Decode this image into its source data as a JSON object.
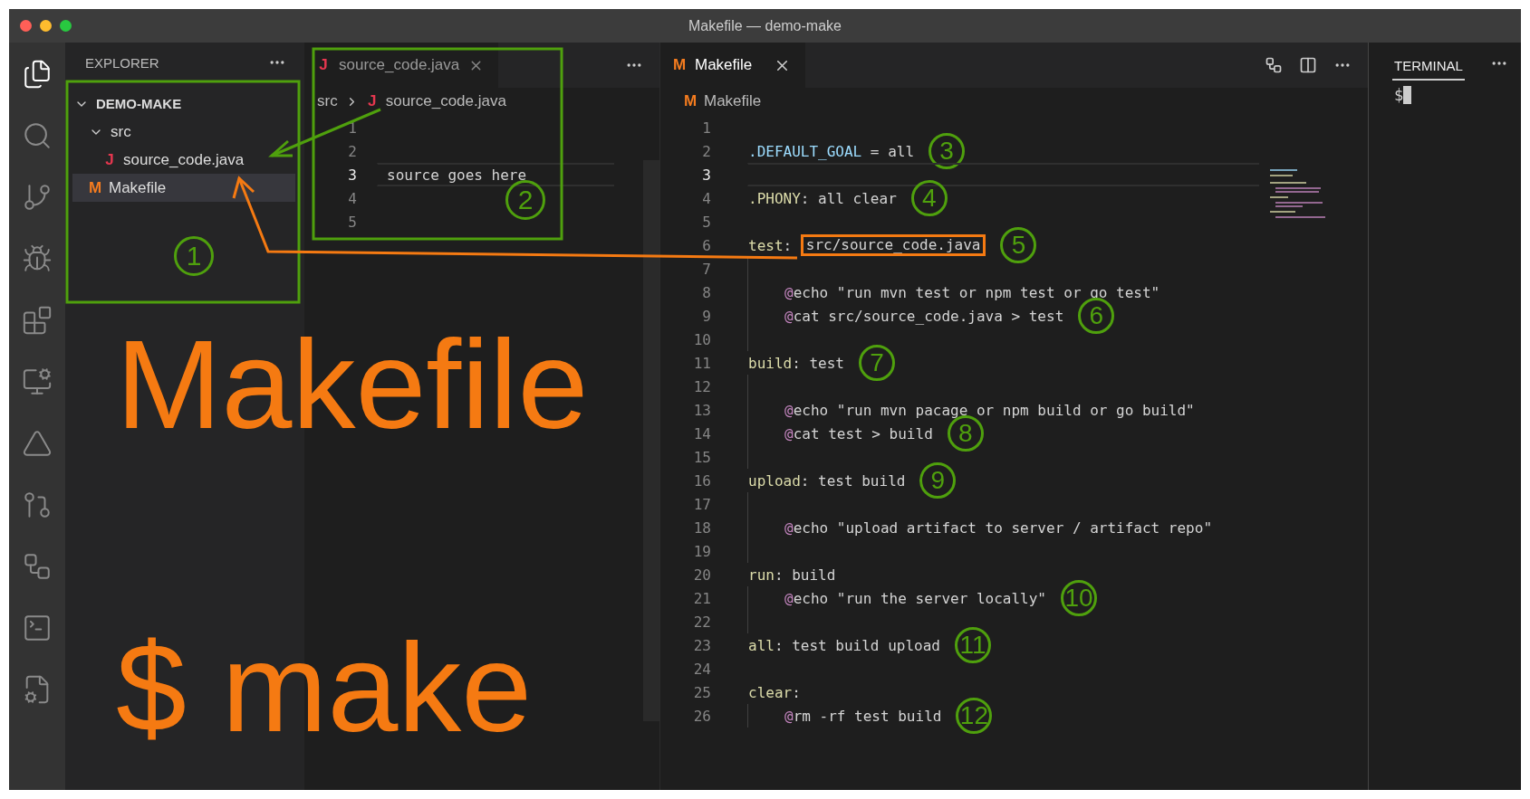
{
  "window": {
    "title": "Makefile — demo-make"
  },
  "activity_bar": [
    {
      "kind": "files",
      "selected": true
    },
    {
      "kind": "search",
      "selected": false
    },
    {
      "kind": "source-control",
      "selected": false
    },
    {
      "kind": "run",
      "selected": false
    },
    {
      "kind": "extensions",
      "selected": false
    },
    {
      "kind": "remote",
      "selected": false
    },
    {
      "kind": "terraform",
      "selected": false
    },
    {
      "kind": "pull-request",
      "selected": false
    },
    {
      "kind": "workflow",
      "selected": false
    },
    {
      "kind": "terminal",
      "selected": false
    },
    {
      "kind": "file-settings",
      "selected": false
    }
  ],
  "explorer": {
    "title": "EXPLORER",
    "callout": "1",
    "tree": [
      {
        "label": "DEMO-MAKE",
        "kind": "root",
        "expanded": true,
        "selected": false,
        "children": [
          {
            "label": "src",
            "kind": "folder",
            "expanded": true,
            "selected": false,
            "children": [
              {
                "label": "source_code.java",
                "kind": "file",
                "icon": "J",
                "color": "#e5374f",
                "selected": false
              }
            ]
          },
          {
            "label": "Makefile",
            "kind": "file",
            "icon": "M",
            "color": "#f57c1f",
            "selected": true
          }
        ]
      }
    ]
  },
  "left_editor": {
    "tab": {
      "icon": "J",
      "label": "source_code.java",
      "selected": true
    },
    "breadcrumb": [
      {
        "label": "src"
      },
      {
        "icon": "J",
        "label": "source_code.java"
      }
    ],
    "callout": "2",
    "lines": [
      {
        "number": "1",
        "current": false
      },
      {
        "number": "2",
        "current": false
      },
      {
        "number": "3",
        "current": true,
        "code": "source goes here"
      },
      {
        "number": "4",
        "current": false
      },
      {
        "number": "5",
        "current": false
      }
    ]
  },
  "right_editor": {
    "tab": {
      "icon": "M",
      "label": "Makefile",
      "selected": true
    },
    "breadcrumb": {
      "icon": "M",
      "label": "Makefile"
    },
    "lines": [
      {
        "number": "1",
        "current": false,
        "indented": false
      },
      {
        "number": "2",
        "current": false,
        "indented": false,
        "tokens": [
          {
            "text": ".DEFAULT_GOAL",
            "kind": "variable"
          },
          {
            "text": " = all",
            "kind": "plain"
          }
        ],
        "callout": "3"
      },
      {
        "number": "3",
        "current": true,
        "indented": false
      },
      {
        "number": "4",
        "current": false,
        "indented": false,
        "tokens": [
          {
            "text": ".PHONY",
            "kind": "target"
          },
          {
            "text": ": all clear",
            "kind": "plain"
          }
        ],
        "callout": "4"
      },
      {
        "number": "5",
        "current": false,
        "indented": false
      },
      {
        "number": "6",
        "current": false,
        "indented": false,
        "tokens": [
          {
            "text": "test",
            "kind": "target"
          },
          {
            "text": ": ",
            "kind": "plain"
          },
          {
            "text": "src/source_code.java",
            "kind": "boxed"
          }
        ],
        "callout": "5"
      },
      {
        "number": "7",
        "current": false,
        "indented": true
      },
      {
        "number": "8",
        "current": false,
        "indented": true,
        "tokens": [
          {
            "text": "@",
            "kind": "at"
          },
          {
            "text": "echo \"run mvn test or npm test or go test\"",
            "kind": "plain"
          }
        ]
      },
      {
        "number": "9",
        "current": false,
        "indented": true,
        "tokens": [
          {
            "text": "@",
            "kind": "at"
          },
          {
            "text": "cat src/source_code.java > test",
            "kind": "plain"
          }
        ],
        "callout": "6"
      },
      {
        "number": "10",
        "current": false,
        "indented": true
      },
      {
        "number": "11",
        "current": false,
        "indented": false,
        "tokens": [
          {
            "text": "build",
            "kind": "target"
          },
          {
            "text": ": test",
            "kind": "plain"
          }
        ],
        "callout": "7"
      },
      {
        "number": "12",
        "current": false,
        "indented": true
      },
      {
        "number": "13",
        "current": false,
        "indented": true,
        "tokens": [
          {
            "text": "@",
            "kind": "at"
          },
          {
            "text": "echo \"run mvn pacage or npm build or go build\"",
            "kind": "plain"
          }
        ]
      },
      {
        "number": "14",
        "current": false,
        "indented": true,
        "tokens": [
          {
            "text": "@",
            "kind": "at"
          },
          {
            "text": "cat test > build",
            "kind": "plain"
          }
        ],
        "callout": "8"
      },
      {
        "number": "15",
        "current": false,
        "indented": true
      },
      {
        "number": "16",
        "current": false,
        "indented": false,
        "tokens": [
          {
            "text": "upload",
            "kind": "target"
          },
          {
            "text": ": test build",
            "kind": "plain"
          }
        ],
        "callout": "9"
      },
      {
        "number": "17",
        "current": false,
        "indented": true
      },
      {
        "number": "18",
        "current": false,
        "indented": true,
        "tokens": [
          {
            "text": "@",
            "kind": "at"
          },
          {
            "text": "echo \"upload artifact to server / artifact repo\"",
            "kind": "plain"
          }
        ]
      },
      {
        "number": "19",
        "current": false,
        "indented": true
      },
      {
        "number": "20",
        "current": false,
        "indented": false,
        "tokens": [
          {
            "text": "run",
            "kind": "target"
          },
          {
            "text": ": build",
            "kind": "plain"
          }
        ]
      },
      {
        "number": "21",
        "current": false,
        "indented": true,
        "tokens": [
          {
            "text": "@",
            "kind": "at"
          },
          {
            "text": "echo \"run the server locally\"",
            "kind": "plain"
          }
        ],
        "callout": "10"
      },
      {
        "number": "22",
        "current": false,
        "indented": true
      },
      {
        "number": "23",
        "current": false,
        "indented": false,
        "tokens": [
          {
            "text": "all",
            "kind": "target"
          },
          {
            "text": ": test build upload",
            "kind": "plain"
          }
        ],
        "callout": "11"
      },
      {
        "number": "24",
        "current": false,
        "indented": false
      },
      {
        "number": "25",
        "current": false,
        "indented": false,
        "tokens": [
          {
            "text": "clear",
            "kind": "target"
          },
          {
            "text": ":",
            "kind": "plain"
          }
        ]
      },
      {
        "number": "26",
        "current": false,
        "indented": true,
        "tokens": [
          {
            "text": "@",
            "kind": "at"
          },
          {
            "text": "rm -rf test build",
            "kind": "plain"
          }
        ],
        "callout": "12"
      }
    ]
  },
  "terminal": {
    "tab": {
      "label": "TERMINAL",
      "selected": true
    },
    "prompt": "$"
  },
  "overlay_texts": [
    "Makefile",
    "$ make"
  ]
}
